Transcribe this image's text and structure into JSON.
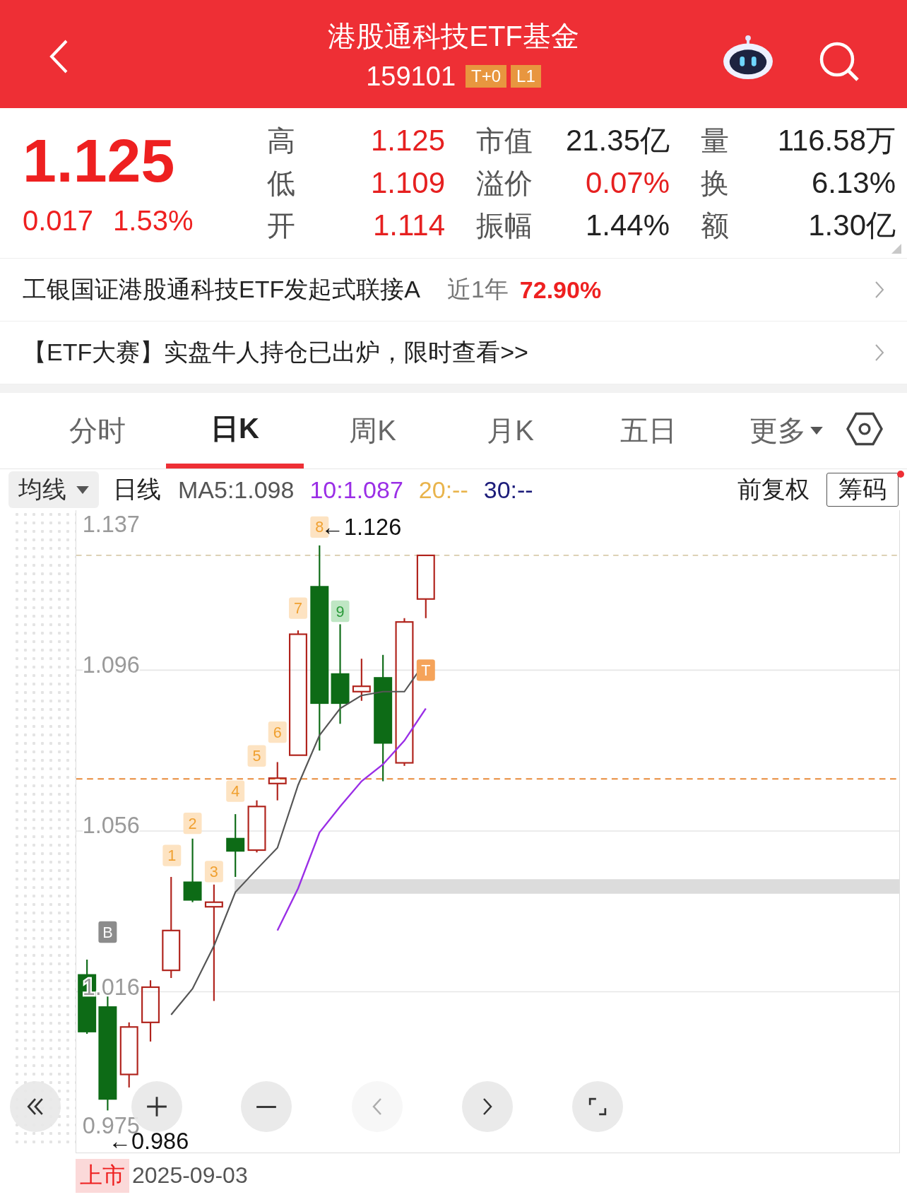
{
  "header": {
    "title": "港股通科技ETF基金",
    "code": "159101",
    "badges": [
      "T+0",
      "L1"
    ]
  },
  "quote": {
    "price": "1.125",
    "change": "0.017",
    "change_pct": "1.53%",
    "stats": [
      {
        "label": "高",
        "value": "1.125",
        "color": "#e62020"
      },
      {
        "label": "市值",
        "value": "21.35亿",
        "color": "#222222"
      },
      {
        "label": "量",
        "value": "116.58万",
        "color": "#222222"
      },
      {
        "label": "低",
        "value": "1.109",
        "color": "#e62020"
      },
      {
        "label": "溢价",
        "value": "0.07%",
        "color": "#e62020"
      },
      {
        "label": "换",
        "value": "6.13%",
        "color": "#222222"
      },
      {
        "label": "开",
        "value": "1.114",
        "color": "#e62020"
      },
      {
        "label": "振幅",
        "value": "1.44%",
        "color": "#222222"
      },
      {
        "label": "额",
        "value": "1.30亿",
        "color": "#222222"
      }
    ]
  },
  "fund_link": {
    "name": "工银国证港股通科技ETF发起式联接A",
    "period": "近1年",
    "return": "72.90%"
  },
  "promo_link": {
    "text": "【ETF大赛】实盘牛人持仓已出炉，限时查看>>"
  },
  "tabs": [
    {
      "label": "分时",
      "selected": false,
      "kind": "plain"
    },
    {
      "label": "日K",
      "selected": true,
      "kind": "plain"
    },
    {
      "label": "周K",
      "selected": false,
      "kind": "plain"
    },
    {
      "label": "月K",
      "selected": false,
      "kind": "plain"
    },
    {
      "label": "五日",
      "selected": false,
      "kind": "plain"
    },
    {
      "label": "更多",
      "selected": false,
      "kind": "dropdown"
    }
  ],
  "ma_bar": {
    "selector": "均线",
    "period": "日线",
    "adjust": "前复权",
    "chip_button": "筹码",
    "notice_dot": true,
    "ma": [
      {
        "label": "MA5:1.098",
        "color": "#555555"
      },
      {
        "label": "10:1.087",
        "color": "#9a2ee6"
      },
      {
        "label": "20:--",
        "color": "#e9b44c"
      },
      {
        "label": "30:--",
        "color": "#1c1c7a"
      }
    ]
  },
  "chart": {
    "y_labels": [
      "1.137",
      "1.096",
      "1.056",
      "1.016",
      "0.975"
    ],
    "high_label": "←1.126",
    "low_label": "←0.986",
    "markers": [
      {
        "text": "1",
        "kind": "count"
      },
      {
        "text": "2",
        "kind": "count"
      },
      {
        "text": "3",
        "kind": "count"
      },
      {
        "text": "4",
        "kind": "count"
      },
      {
        "text": "5",
        "kind": "count"
      },
      {
        "text": "6",
        "kind": "count"
      },
      {
        "text": "7",
        "kind": "count"
      },
      {
        "text": "8",
        "kind": "count"
      },
      {
        "text": "9",
        "kind": "top"
      },
      {
        "text": "B",
        "kind": "buy"
      },
      {
        "text": "T",
        "kind": "trade"
      }
    ],
    "controls": [
      {
        "kind": "collapse",
        "disabled": false
      },
      {
        "kind": "zoom-in",
        "disabled": false
      },
      {
        "kind": "zoom-out",
        "disabled": false
      },
      {
        "kind": "prev",
        "disabled": true
      },
      {
        "kind": "next",
        "disabled": false
      },
      {
        "kind": "fullscreen",
        "disabled": false
      }
    ]
  },
  "footer": {
    "listing_badge": "上市",
    "listing_date": "2025-09-03"
  }
}
